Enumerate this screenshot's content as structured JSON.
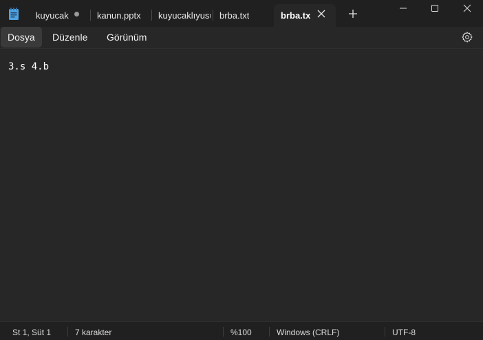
{
  "tabs": [
    {
      "label": "kuyucak",
      "modified": true
    },
    {
      "label": "kanun.pptx"
    },
    {
      "label": "kuyucaklıyusuf"
    },
    {
      "label": "brba.txt"
    },
    {
      "label": "brba.tx",
      "active": true
    }
  ],
  "menu": {
    "file": "Dosya",
    "edit": "Düzenle",
    "view": "Görünüm"
  },
  "editor": {
    "content": "3.s 4.b"
  },
  "status": {
    "position": "St 1, Süt 1",
    "char_count": "7 karakter",
    "zoom": "%100",
    "line_ending": "Windows (CRLF)",
    "encoding": "UTF-8"
  },
  "colors": {
    "background": "#272727",
    "titlebar": "#202020",
    "text": "#ffffff",
    "app_icon": "#4fa3e0"
  },
  "icons": {
    "app": "notepad-icon",
    "close_tab": "close-icon",
    "new_tab": "plus-icon",
    "settings": "gear-icon",
    "minimize": "minimize-icon",
    "maximize": "maximize-icon",
    "close_window": "close-window-icon"
  }
}
